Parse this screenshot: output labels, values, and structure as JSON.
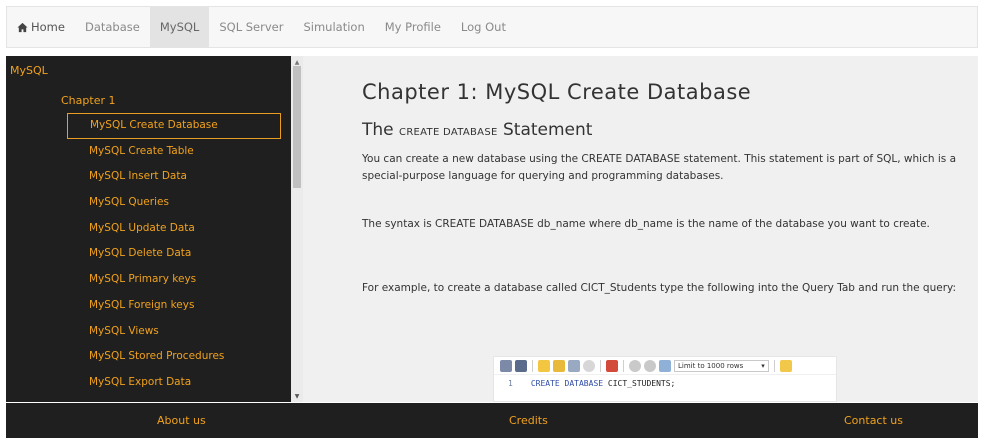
{
  "nav": {
    "home": "Home",
    "items": [
      "Database",
      "MySQL",
      "SQL Server",
      "Simulation",
      "My Profile",
      "Log Out"
    ],
    "active_index": 1
  },
  "sidebar": {
    "root": "MySQL",
    "chapter": "Chapter 1",
    "items": [
      "MySQL Create Database",
      "MySQL Create Table",
      "MySQL Insert Data",
      "MySQL Queries",
      "MySQL Update Data",
      "MySQL Delete Data",
      "MySQL Primary keys",
      "MySQL Foreign keys",
      "MySQL Views",
      "MySQL Stored Procedures",
      "MySQL Export Data"
    ],
    "selected_index": 0
  },
  "content": {
    "title": "Chapter 1: MySQL Create Database",
    "subtitle_pre": "The ",
    "subtitle_small": "CREATE DATABASE",
    "subtitle_post": " Statement",
    "para1": "You can create a new database using the CREATE DATABASE statement. This statement is part of SQL, which is a special-purpose language for querying and programming databases.",
    "para2": "The syntax is CREATE DATABASE db_name where db_name is the name of the database you want to create.",
    "para3": "For example, to create a database called CICT_Students type the following into the Query Tab and run the query:"
  },
  "editor": {
    "limit_label": "Limit to 1000 rows",
    "line_number": "1",
    "keyword": "CREATE DATABASE",
    "rest": "CICT_STUDENTS;"
  },
  "footer": {
    "about": "About us",
    "credits": "Credits",
    "contact": "Contact us"
  },
  "colors": {
    "accent": "#f1a21d",
    "dark_bg": "#1f1f1f",
    "content_bg": "#f0f0f0"
  }
}
